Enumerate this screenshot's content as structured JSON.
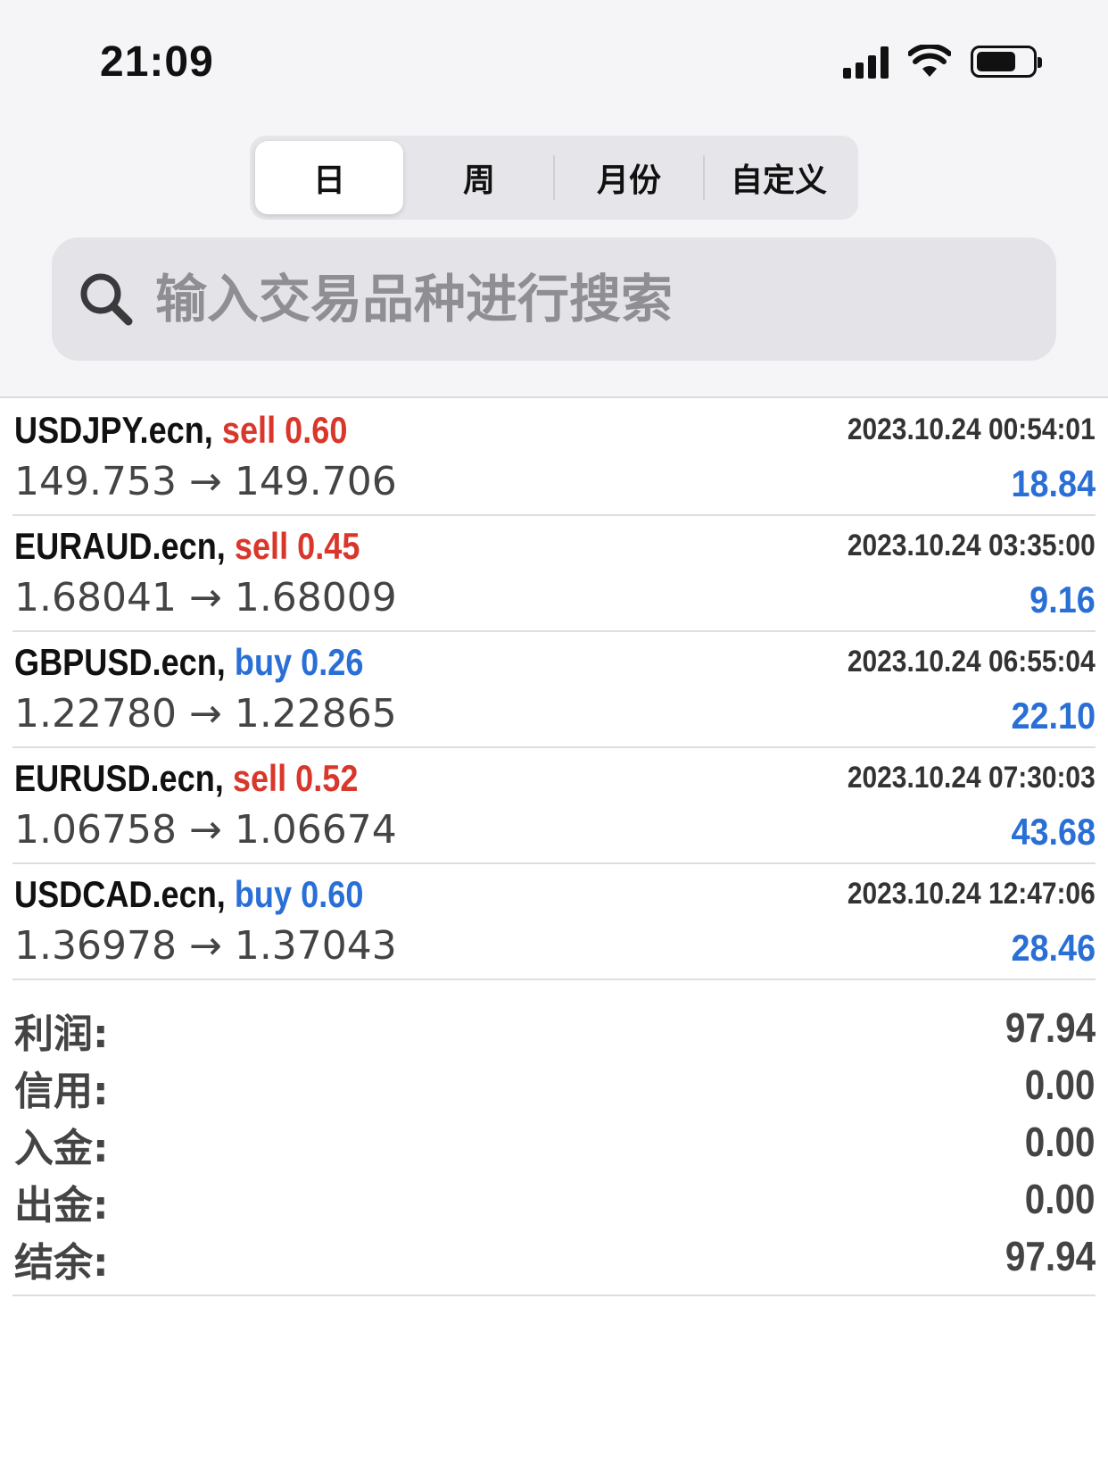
{
  "status_bar": {
    "time": "21:09"
  },
  "tabs": [
    {
      "label": "日",
      "active": true
    },
    {
      "label": "周",
      "active": false
    },
    {
      "label": "月份",
      "active": false
    },
    {
      "label": "自定义",
      "active": false
    }
  ],
  "search": {
    "placeholder": "输入交易品种进行搜索"
  },
  "trades": [
    {
      "symbol": "USDJPY.ecn,",
      "side": "sell",
      "lots": "0.60",
      "time": "2023.10.24 00:54:01",
      "open": "149.753",
      "close": "149.706",
      "arrow": "→",
      "profit": "18.84"
    },
    {
      "symbol": "EURAUD.ecn,",
      "side": "sell",
      "lots": "0.45",
      "time": "2023.10.24 03:35:00",
      "open": "1.68041",
      "close": "1.68009",
      "arrow": "→",
      "profit": "9.16"
    },
    {
      "symbol": "GBPUSD.ecn,",
      "side": "buy",
      "lots": "0.26",
      "time": "2023.10.24 06:55:04",
      "open": "1.22780",
      "close": "1.22865",
      "arrow": "→",
      "profit": "22.10"
    },
    {
      "symbol": "EURUSD.ecn,",
      "side": "sell",
      "lots": "0.52",
      "time": "2023.10.24 07:30:03",
      "open": "1.06758",
      "close": "1.06674",
      "arrow": "→",
      "profit": "43.68"
    },
    {
      "symbol": "USDCAD.ecn,",
      "side": "buy",
      "lots": "0.60",
      "time": "2023.10.24 12:47:06",
      "open": "1.36978",
      "close": "1.37043",
      "arrow": "→",
      "profit": "28.46"
    }
  ],
  "summary": [
    {
      "label": "利润:",
      "value": "97.94"
    },
    {
      "label": "信用:",
      "value": "0.00"
    },
    {
      "label": "入金:",
      "value": "0.00"
    },
    {
      "label": "出金:",
      "value": "0.00"
    },
    {
      "label": "结余:",
      "value": "97.94"
    }
  ],
  "colors": {
    "sell": "#d9372b",
    "buy": "#2a6fd6",
    "profit": "#2a6fd6"
  },
  "icons": {
    "search": "search-icon",
    "signal": "cellular-signal-icon",
    "wifi": "wifi-icon",
    "battery": "battery-icon"
  }
}
